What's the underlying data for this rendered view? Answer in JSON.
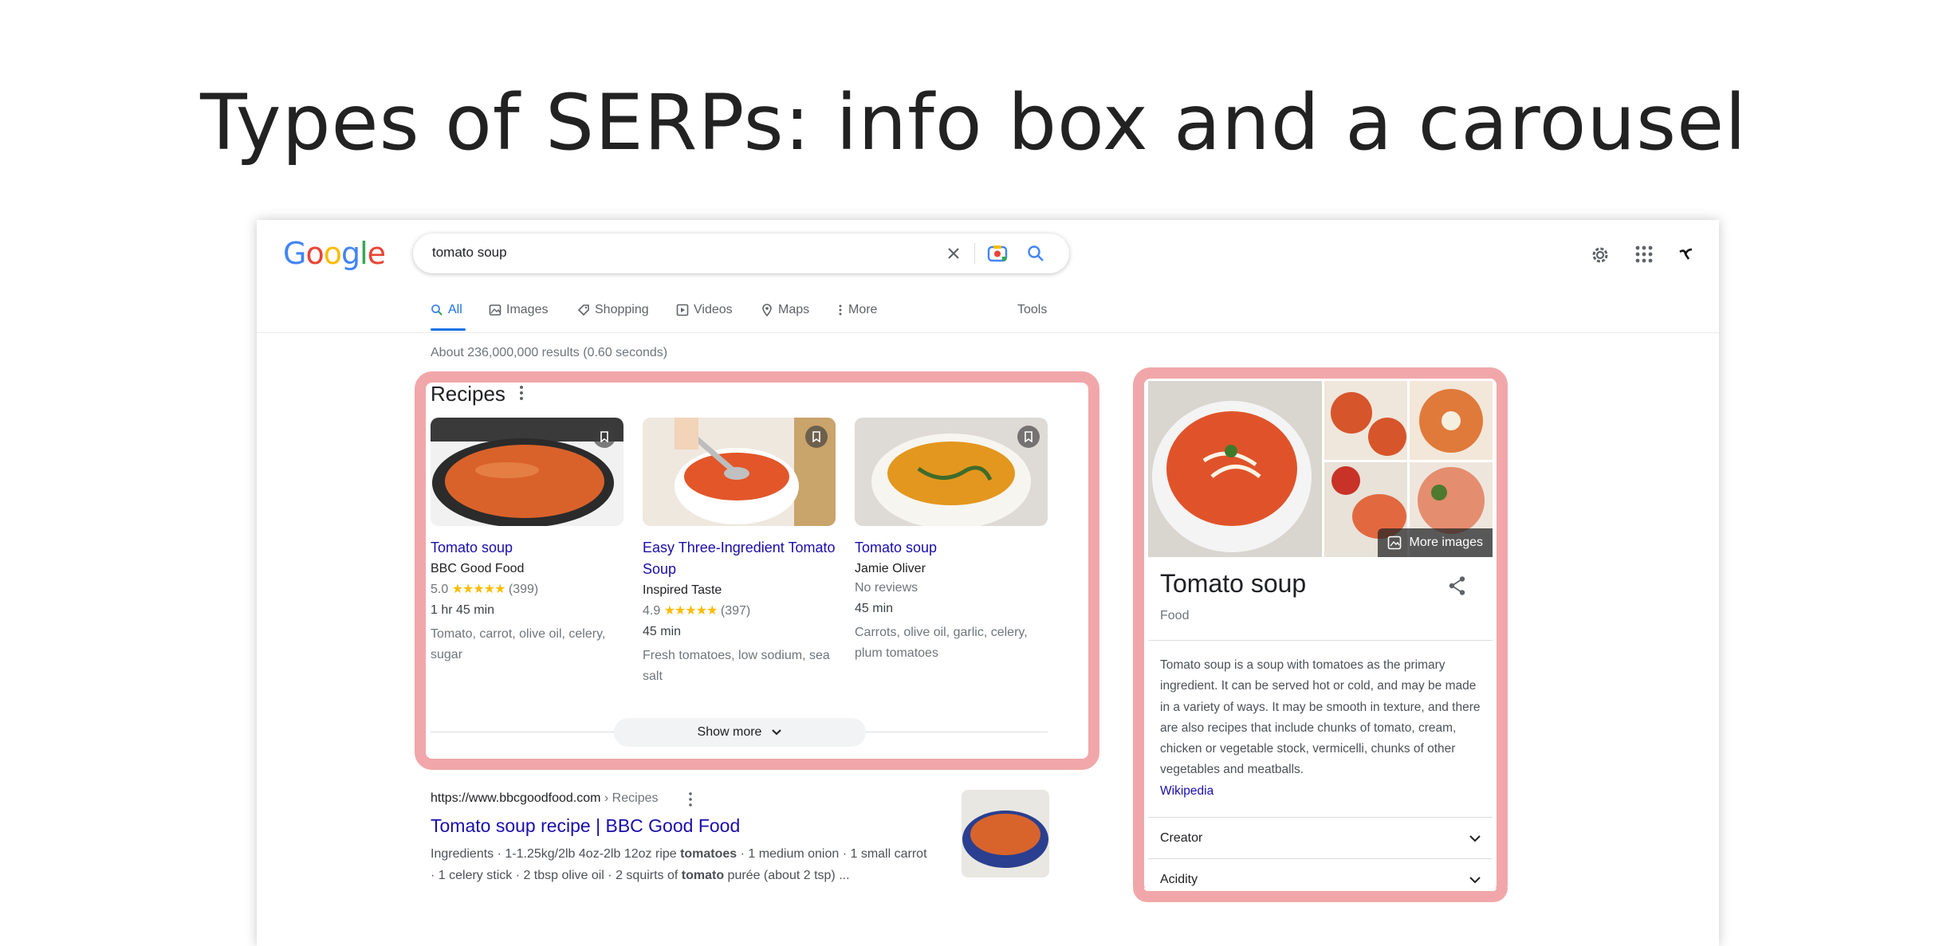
{
  "slide": {
    "title": "Types of SERPs: info box and a carousel"
  },
  "header": {
    "logo": [
      "G",
      "o",
      "o",
      "g",
      "l",
      "e"
    ],
    "logo_colors": [
      "#4285f4",
      "#ea4335",
      "#fbbc05",
      "#4285f4",
      "#34a853",
      "#ea4335"
    ],
    "search_value": "tomato soup",
    "icons": [
      "clear-icon",
      "lens-camera-icon",
      "search-icon",
      "settings-gear-icon",
      "apps-grid-icon",
      "account-avatar-icon"
    ]
  },
  "tabs": [
    {
      "label": "All",
      "icon": "search-icon",
      "active": true
    },
    {
      "label": "Images",
      "icon": "image-icon"
    },
    {
      "label": "Shopping",
      "icon": "tag-icon"
    },
    {
      "label": "Videos",
      "icon": "play-icon"
    },
    {
      "label": "Maps",
      "icon": "pin-icon"
    },
    {
      "label": "More",
      "icon": "more-vert-icon"
    }
  ],
  "tools_label": "Tools",
  "result_stats": "About 236,000,000 results (0.60 seconds)",
  "recipes": {
    "heading": "Recipes",
    "cards": [
      {
        "title": "Tomato soup",
        "source": "BBC Good Food",
        "rating": "5.0",
        "stars": "★★★★★",
        "reviews": "(399)",
        "time": "1 hr 45 min",
        "ingredients": "Tomato, carrot, olive oil, celery, sugar"
      },
      {
        "title": "Easy Three-Ingredient Tomato Soup",
        "source": "Inspired Taste",
        "rating": "4.9",
        "stars": "★★★★★",
        "reviews": "(397)",
        "time": "45 min",
        "ingredients": "Fresh tomatoes, low sodium, sea salt"
      },
      {
        "title": "Tomato soup",
        "source": "Jamie Oliver",
        "rating_text": "No reviews",
        "time": "45 min",
        "ingredients": "Carrots, olive oil, garlic, celery, plum tomatoes"
      }
    ],
    "show_more": "Show more"
  },
  "organic": {
    "url": "https://www.bbcgoodfood.com",
    "breadcrumb": "› Recipes",
    "title": "Tomato soup recipe | BBC Good Food",
    "snippet_line1": [
      {
        "t": "Ingredients · 1-1.25kg/2lb 4oz-2lb 12oz ripe "
      },
      {
        "t": "tomatoes",
        "b": true
      },
      {
        "t": " · 1 medium onion · 1 small carrot"
      }
    ],
    "snippet_line2": [
      {
        "t": "· 1 celery stick · 2 tbsp olive oil · 2 squirts of "
      },
      {
        "t": "tomato",
        "b": true
      },
      {
        "t": " purée (about 2 tsp) ..."
      }
    ]
  },
  "knowledge_panel": {
    "more_images": "More images",
    "title": "Tomato soup",
    "subtitle": "Food",
    "description": "Tomato soup is a soup with tomatoes as the primary ingredient. It can be served hot or cold, and may be made in a variety of ways. It may be smooth in texture, and there are also recipes that include chunks of tomato, cream, chicken or vegetable stock, vermicelli, chunks of other vegetables and meatballs.",
    "source_link": "Wikipedia",
    "rows": [
      "Creator",
      "Acidity"
    ]
  },
  "colors": {
    "link": "#1a0dab",
    "highlight_border": "#f1a7a9",
    "star": "#fbbc04",
    "soup": "#d9541e"
  }
}
